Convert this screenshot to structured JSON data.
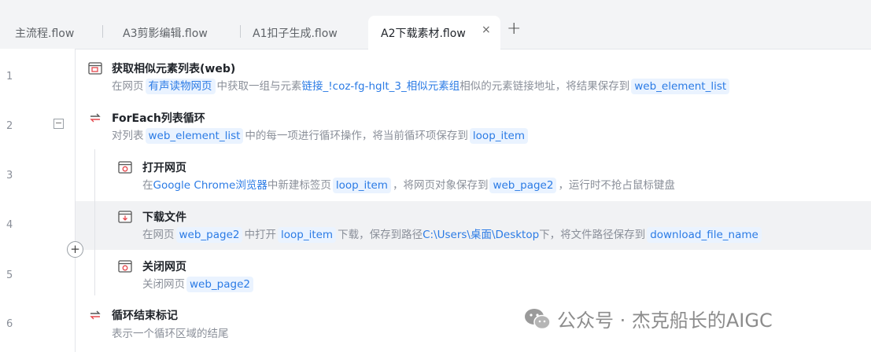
{
  "tabs": [
    {
      "label": "主流程.flow"
    },
    {
      "label": "A3剪影编辑.flow"
    },
    {
      "label": "A1扣子生成.flow"
    },
    {
      "label": "A2下载素材.flow",
      "active": true
    }
  ],
  "tab_close": "×",
  "tab_add": "+",
  "gutter": {
    "collapse": "−",
    "add": "+"
  },
  "line_numbers": [
    "1",
    "2",
    "3",
    "4",
    "5",
    "6"
  ],
  "steps": [
    {
      "title": "获取相似元素列表(web)",
      "desc": {
        "t1": "在网页",
        "tok1": "有声读物网页",
        "t2": "中获取一组与元素",
        "link": "链接_!coz-fg-hglt_3_相似元素组",
        "t3": "相似的元素链接地址，将结果保存到",
        "tok2": "web_element_list"
      }
    },
    {
      "title": "ForEach列表循环",
      "desc": {
        "t1": "对列表",
        "tok1": "web_element_list",
        "t2": "中的每一项进行循环操作，将当前循环项保存到",
        "tok2": "loop_item"
      }
    },
    {
      "title": "打开网页",
      "desc": {
        "t1": "在",
        "link": "Google Chrome浏览器",
        "t2": "中新建标签页",
        "tok1": "loop_item",
        "t3": "，将网页对象保存到",
        "tok2": "web_page2",
        "t4": "，运行时不抢占鼠标键盘"
      }
    },
    {
      "title": "下载文件",
      "desc": {
        "t1": "在网页",
        "tok1": "web_page2",
        "t2": "中打开",
        "tok2": "loop_item",
        "t3": "下载，保存到路径",
        "path": "C:\\Users\\桌面\\Desktop",
        "t4": "下，将文件路径保存到",
        "tok3": "download_file_name"
      }
    },
    {
      "title": "关闭网页",
      "desc": {
        "t1": "关闭网页",
        "tok1": "web_page2"
      }
    },
    {
      "title": "循环结束标记",
      "desc": {
        "t1": "表示一个循环区域的结尾"
      }
    }
  ],
  "watermark": "公众号 · 杰克船长的AIGC",
  "colors": {
    "accent": "#2b7be5",
    "token_bg": "#eaf3ff",
    "icon_red": "#e5484d"
  }
}
